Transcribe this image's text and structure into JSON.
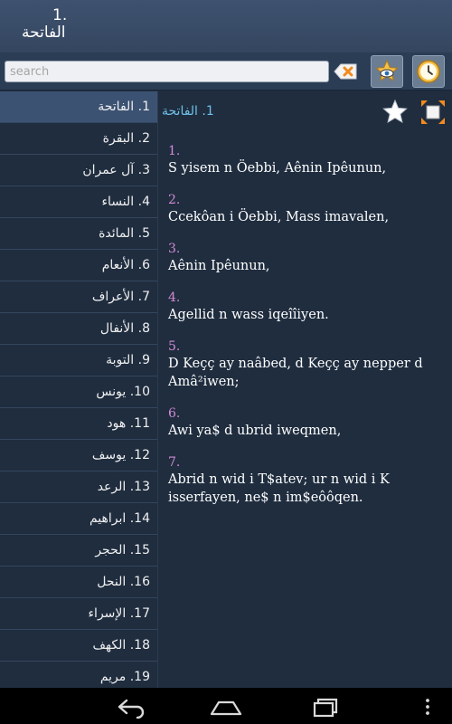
{
  "header": {
    "number": "1.",
    "title": "الفاتحة"
  },
  "search": {
    "placeholder": "search"
  },
  "icons": {
    "clear": "backspace-x-icon",
    "eye_star": "favorites-eye-icon",
    "history": "clock-icon",
    "star": "star-icon",
    "expand": "fullscreen-icon",
    "back": "back-icon",
    "home": "home-icon",
    "recents": "recent-apps-icon",
    "menu": "overflow-menu-icon"
  },
  "colors": {
    "accent_title": "#6fc1e8",
    "verse_number": "#d38ad4",
    "star": "#f4c24a"
  },
  "sidebar": {
    "items": [
      {
        "label": "1. الفاتحة"
      },
      {
        "label": "2. البقرة"
      },
      {
        "label": "3. آل عمران"
      },
      {
        "label": "4. النساء"
      },
      {
        "label": "5. المائدة"
      },
      {
        "label": "6. الأنعام"
      },
      {
        "label": "7. الأعراف"
      },
      {
        "label": "8. الأنفال"
      },
      {
        "label": "9. التوبة"
      },
      {
        "label": "10. يونس"
      },
      {
        "label": "11. هود"
      },
      {
        "label": "12. يوسف"
      },
      {
        "label": "13. الرعد"
      },
      {
        "label": "14. ابراهيم"
      },
      {
        "label": "15. الحجر"
      },
      {
        "label": "16. النحل"
      },
      {
        "label": "17. الإسراء"
      },
      {
        "label": "18. الكهف"
      },
      {
        "label": "19. مريم"
      }
    ]
  },
  "content": {
    "title": "1. الفاتحة",
    "verses": [
      {
        "num": "1.",
        "text": "S yisem n Öebbi, Aênin Ipêunun,"
      },
      {
        "num": "2.",
        "text": "Ccekôan i Öebbi, Mass imavalen,"
      },
      {
        "num": "3.",
        "text": "Aênin Ipêunun,"
      },
      {
        "num": "4.",
        "text": "Agellid n wass iqeîîiyen."
      },
      {
        "num": "5.",
        "text": "D Keçç ay naâbed, d Keçç ay nepper d Amâ²iwen;"
      },
      {
        "num": "6.",
        "text": "Awi ya$ d ubrid iweqmen,"
      },
      {
        "num": "7.",
        "text": "Abrid n wid i T$atev; ur n wid i K isserfayen, ne$ n im$eôôqen."
      }
    ]
  }
}
